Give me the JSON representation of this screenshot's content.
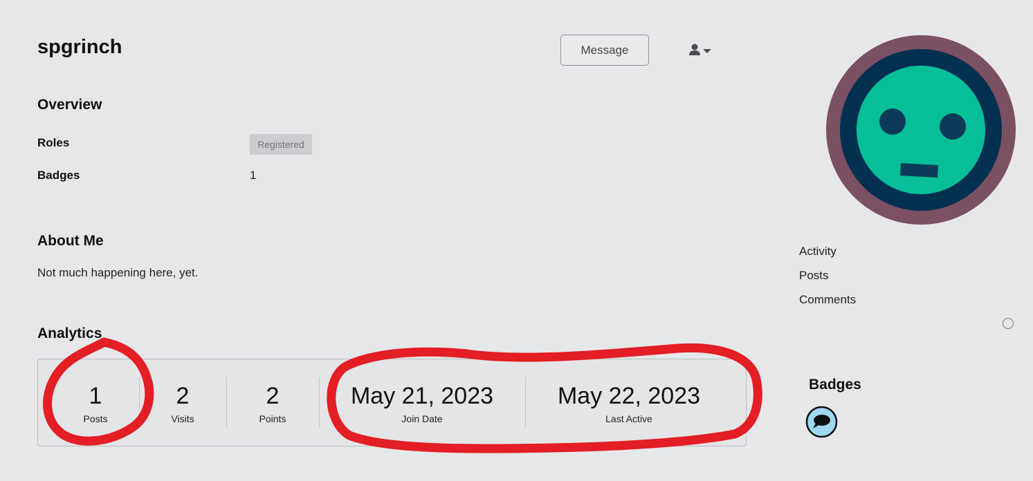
{
  "profile": {
    "username": "spgrinch",
    "message_label": "Message"
  },
  "overview": {
    "title": "Overview",
    "roles_label": "Roles",
    "role_value": "Registered",
    "badges_label": "Badges",
    "badges_count": "1"
  },
  "about": {
    "title": "About Me",
    "text": "Not much happening here, yet."
  },
  "analytics": {
    "title": "Analytics",
    "stats": [
      {
        "value": "1",
        "label": "Posts"
      },
      {
        "value": "2",
        "label": "Visits"
      },
      {
        "value": "2",
        "label": "Points"
      },
      {
        "value": "May 21, 2023",
        "label": "Join Date"
      },
      {
        "value": "May 22, 2023",
        "label": "Last Active"
      }
    ]
  },
  "sidebar": {
    "links": [
      "Activity",
      "Posts",
      "Comments"
    ],
    "badges_title": "Badges"
  },
  "icons": {
    "user_menu": "user-dropdown-icon",
    "badge": "speech-bubble-icon"
  },
  "colors": {
    "annotation": "#e31e24",
    "avatar_ring": "#7c5063",
    "avatar_inner": "#023050",
    "avatar_face": "#06bf99",
    "badge_bg": "#9fd8f2"
  }
}
